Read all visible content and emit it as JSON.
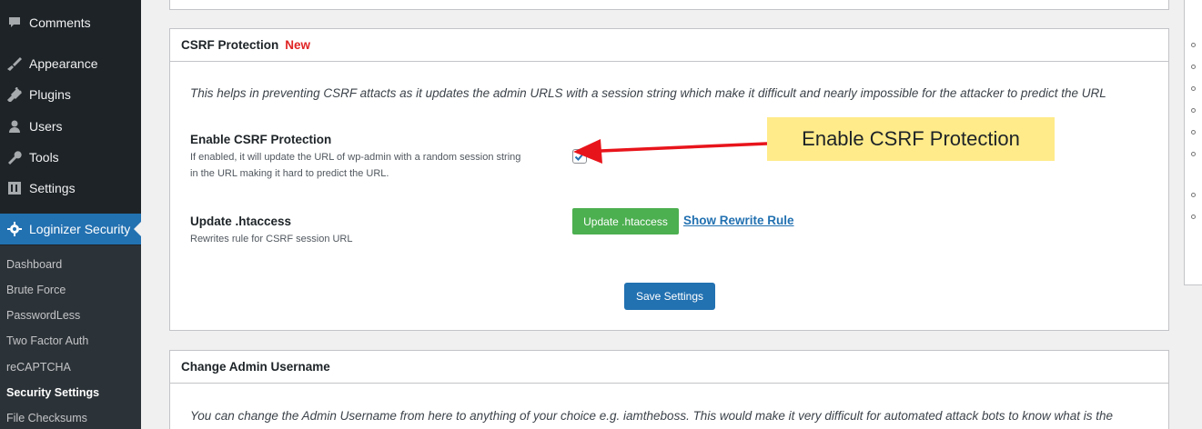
{
  "sidebar": {
    "menu": [
      {
        "label": "Comments",
        "icon": "comment-icon"
      },
      {
        "label": "Appearance",
        "icon": "brush-icon"
      },
      {
        "label": "Plugins",
        "icon": "plug-icon"
      },
      {
        "label": "Users",
        "icon": "user-icon"
      },
      {
        "label": "Tools",
        "icon": "wrench-icon"
      },
      {
        "label": "Settings",
        "icon": "settings-icon"
      },
      {
        "label": "Loginizer Security",
        "icon": "gear-icon"
      }
    ],
    "submenu": [
      "Dashboard",
      "Brute Force",
      "PasswordLess",
      "Two Factor Auth",
      "reCAPTCHA",
      "Security Settings",
      "File Checksums"
    ],
    "current_submenu": "Security Settings"
  },
  "csrf_panel": {
    "title": "CSRF Protection",
    "badge": "New",
    "description": "This helps in preventing CSRF attacts as it updates the admin URLS with a session string which make it difficult and nearly impossible for the attacker to predict the URL",
    "enable_label": "Enable CSRF Protection",
    "enable_help_line1": "If enabled, it will update the URL of wp-admin with a random session string",
    "enable_help_line2": "in the URL making it hard to predict the URL.",
    "enable_checked": true,
    "htaccess_label": "Update .htaccess",
    "htaccess_help": "Rewrites rule for CSRF session URL",
    "htaccess_button": "Update .htaccess",
    "rewrite_link": "Show Rewrite Rule",
    "save_button": "Save Settings"
  },
  "callout": {
    "text": "Enable CSRF Protection"
  },
  "admin_panel": {
    "title": "Change Admin Username",
    "description": "You can change the Admin Username from here to anything of your choice e.g. iamtheboss. This would make it very difficult for automated attack bots to know what is the"
  },
  "colors": {
    "sidebar_bg": "#1d2327",
    "active_bg": "#2271b1",
    "badge_red": "#e02424",
    "green_button": "#4caf50",
    "blue_button": "#2271b1",
    "callout_bg": "#ffeb8a",
    "arrow_red": "#e8141b"
  }
}
